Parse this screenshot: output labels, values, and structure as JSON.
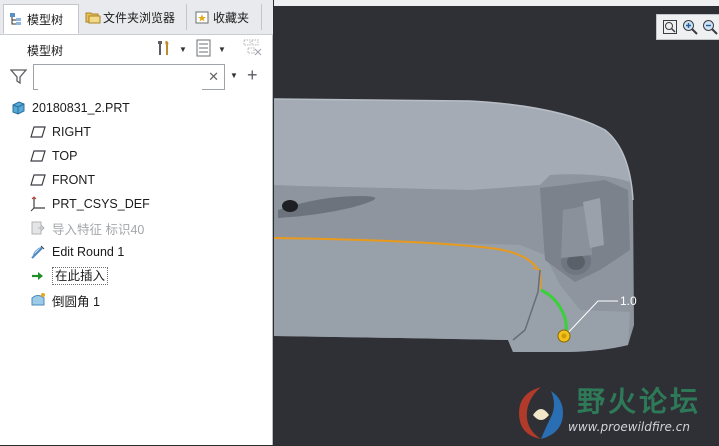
{
  "tabs": [
    {
      "label": "模型树",
      "icon": "model-tree-icon",
      "active": true
    },
    {
      "label": "文件夹浏览器",
      "icon": "folder-browser-icon",
      "active": false
    },
    {
      "label": "收藏夹",
      "icon": "favorites-icon",
      "active": false
    }
  ],
  "panel": {
    "title": "模型树",
    "settings_icon": "tools-icon",
    "show_icon": "list-view-icon",
    "filter_icon": "filter-icon"
  },
  "search": {
    "value": "",
    "placeholder": ""
  },
  "tree": {
    "items": [
      {
        "label": "20180831_2.PRT",
        "icon": "part-icon"
      },
      {
        "label": "RIGHT",
        "icon": "datum-plane-icon"
      },
      {
        "label": "TOP",
        "icon": "datum-plane-icon"
      },
      {
        "label": "FRONT",
        "icon": "datum-plane-icon"
      },
      {
        "label": "PRT_CSYS_DEF",
        "icon": "coordinate-system-icon"
      },
      {
        "label": "导入特征 标识40",
        "icon": "import-feature-icon",
        "disabled": true
      },
      {
        "label": "Edit Round 1",
        "icon": "edit-round-icon"
      },
      {
        "label": "在此插入",
        "icon": "insert-here-arrow-icon"
      },
      {
        "label": "倒圆角 1",
        "icon": "round-icon"
      }
    ]
  },
  "viewport": {
    "dimension_value": "1.0",
    "zoom_icons": [
      "zoom-fit-icon",
      "zoom-in-icon",
      "zoom-out-icon"
    ]
  },
  "watermark": {
    "title": "野火论坛",
    "url": "www.proewildfire.cn"
  },
  "colors": {
    "viewport_bg": "#2e3035",
    "part_surface": "#8f969f",
    "edge_orange": "#e89a1c",
    "round_green": "#38d13a",
    "handle_yellow": "#f2c21b",
    "watermark_green": "#2e7a58"
  }
}
